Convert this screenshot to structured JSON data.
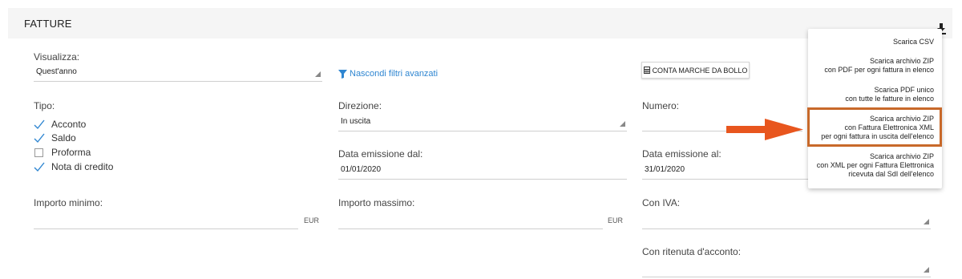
{
  "header": {
    "title": "FATTURE"
  },
  "filters": {
    "visualizza": {
      "label": "Visualizza:",
      "value": "Quest'anno"
    },
    "toggle_filters": "Nascondi filtri avanzati",
    "bollo_button": "CONTA MARCHE DA BOLLO",
    "tipo": {
      "label": "Tipo:",
      "options": [
        {
          "label": "Acconto",
          "checked": true
        },
        {
          "label": "Saldo",
          "checked": true
        },
        {
          "label": "Proforma",
          "checked": false
        },
        {
          "label": "Nota di credito",
          "checked": true
        }
      ]
    },
    "direzione": {
      "label": "Direzione:",
      "value": "In uscita"
    },
    "numero": {
      "label": "Numero:"
    },
    "data_dal": {
      "label": "Data emissione dal:",
      "value": "01/01/2020"
    },
    "data_al": {
      "label": "Data emissione al:",
      "value": "31/01/2020"
    },
    "importo_min": {
      "label": "Importo minimo:",
      "unit": "EUR"
    },
    "importo_max": {
      "label": "Importo massimo:",
      "unit": "EUR"
    },
    "con_iva": {
      "label": "Con IVA:"
    },
    "con_ritenuta": {
      "label": "Con ritenuta d'acconto:"
    }
  },
  "download_menu": {
    "items": [
      {
        "lines": [
          "Scarica CSV"
        ]
      },
      {
        "lines": [
          "Scarica archivio ZIP",
          "con PDF per ogni fattura in elenco"
        ]
      },
      {
        "lines": [
          "Scarica PDF unico",
          "con tutte le fatture in elenco"
        ]
      },
      {
        "lines": [
          "Scarica archivio ZIP",
          "con Fattura Elettronica XML",
          "per ogni fattura in uscita dell'elenco"
        ]
      },
      {
        "lines": [
          "Scarica archivio ZIP",
          "con XML per ogni Fattura Elettronica",
          "ricevuta dal SdI dell'elenco"
        ]
      }
    ]
  },
  "colors": {
    "accent": "#2f86d1",
    "check": "#2f86d1",
    "highlight": "#c8692a",
    "arrow": "#e8561e"
  },
  "icons": {
    "download": "download-icon",
    "filter": "filter-icon",
    "calculator": "calculator-icon"
  }
}
